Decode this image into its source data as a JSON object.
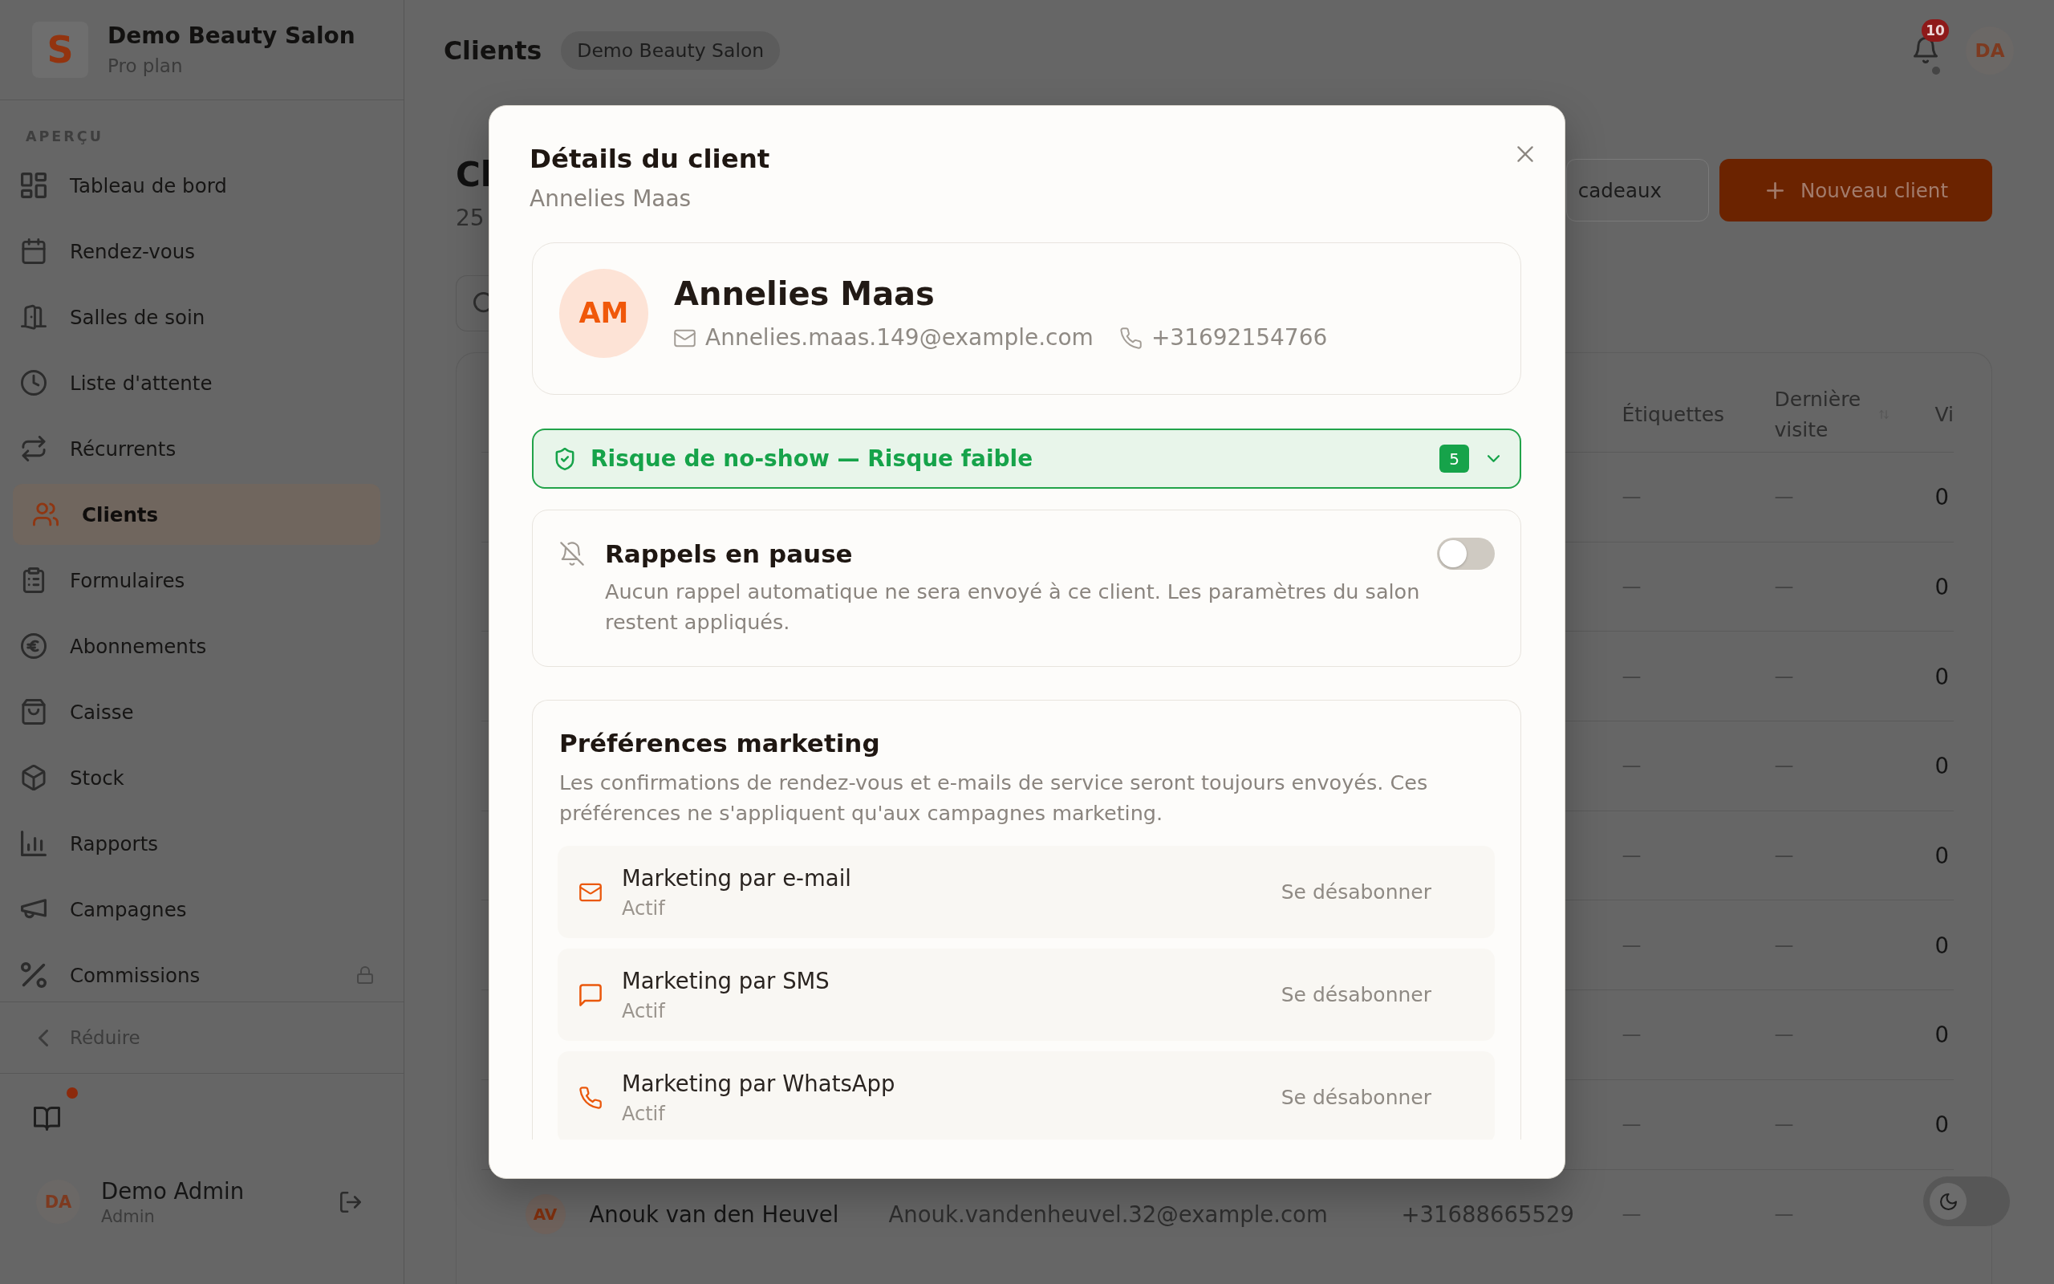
{
  "sidebar": {
    "brand": {
      "logo": "S",
      "name": "Demo Beauty Salon",
      "plan": "Pro plan"
    },
    "section_label": "APERÇU",
    "items": [
      {
        "label": "Tableau de bord",
        "selected": false,
        "locked": false
      },
      {
        "label": "Rendez-vous",
        "selected": false,
        "locked": false
      },
      {
        "label": "Salles de soin",
        "selected": false,
        "locked": false
      },
      {
        "label": "Liste d'attente",
        "selected": false,
        "locked": false
      },
      {
        "label": "Récurrents",
        "selected": false,
        "locked": false
      },
      {
        "label": "Clients",
        "selected": true,
        "locked": false
      },
      {
        "label": "Formulaires",
        "selected": false,
        "locked": false
      },
      {
        "label": "Abonnements",
        "selected": false,
        "locked": false
      },
      {
        "label": "Caisse",
        "selected": false,
        "locked": false
      },
      {
        "label": "Stock",
        "selected": false,
        "locked": false
      },
      {
        "label": "Rapports",
        "selected": false,
        "locked": false
      },
      {
        "label": "Campagnes",
        "selected": false,
        "locked": false
      },
      {
        "label": "Commissions",
        "selected": false,
        "locked": true
      }
    ],
    "collapse_label": "Réduire",
    "guide": {
      "unread": true
    },
    "user": {
      "initials": "DA",
      "name": "Demo Admin",
      "role": "Admin"
    }
  },
  "header": {
    "title": "Clients",
    "salon_badge": "Demo Beauty Salon",
    "notification_count": "10",
    "user_initials": "DA"
  },
  "page": {
    "title": "Cl",
    "count": "25",
    "buttons": [
      {
        "label": "cadeaux",
        "kind": "secondary"
      },
      {
        "label": "Nouveau client",
        "kind": "primary"
      }
    ],
    "table": {
      "columns": [
        "Étiquettes",
        "Dernière visite",
        "Vi"
      ],
      "rows": [
        {
          "tags": "—",
          "last_visit": "—",
          "column_6": "0"
        },
        {
          "tags": "—",
          "last_visit": "—",
          "column_6": "0"
        },
        {
          "tags": "—",
          "last_visit": "—",
          "column_6": "0"
        },
        {
          "tags": "—",
          "last_visit": "—",
          "column_6": "0"
        },
        {
          "tags": "—",
          "last_visit": "—",
          "column_6": "0"
        },
        {
          "tags": "—",
          "last_visit": "—",
          "column_6": "0"
        },
        {
          "tags": "—",
          "last_visit": "—",
          "column_6": "0"
        },
        {
          "tags": "—",
          "last_visit": "—",
          "column_6": "0"
        },
        {
          "avatar": "AV",
          "client": "Anouk van den Heuvel",
          "email": "Anouk.vandenheuvel.32@example.com",
          "phone": "+31688665529",
          "tags": "—",
          "last_visit": "—"
        }
      ]
    }
  },
  "theme_toggle": {
    "dark": false
  },
  "modal": {
    "title": "Détails du client",
    "subtitle": "Annelies Maas",
    "client": {
      "initials": "AM",
      "name": "Annelies Maas",
      "email": "Annelies.maas.149@example.com",
      "phone": "+31692154766"
    },
    "risk": {
      "label": "Risque de no-show — Risque faible",
      "score": "5",
      "expanded": false
    },
    "reminders": {
      "title": "Rappels en pause",
      "description": "Aucun rappel automatique ne sera envoyé à ce client. Les paramètres du salon restent appliqués.",
      "on": false
    },
    "marketing": {
      "title": "Préférences marketing",
      "description": "Les confirmations de rendez-vous et e-mails de service seront toujours envoyés. Ces préférences ne s'appliquent qu'aux campagnes marketing.",
      "channels": [
        {
          "label": "Marketing par e-mail",
          "status": "Actif",
          "action": "Se désabonner"
        },
        {
          "label": "Marketing par SMS",
          "status": "Actif",
          "action": "Se désabonner"
        },
        {
          "label": "Marketing par WhatsApp",
          "status": "Actif",
          "action": "Se désabonner"
        }
      ]
    }
  }
}
